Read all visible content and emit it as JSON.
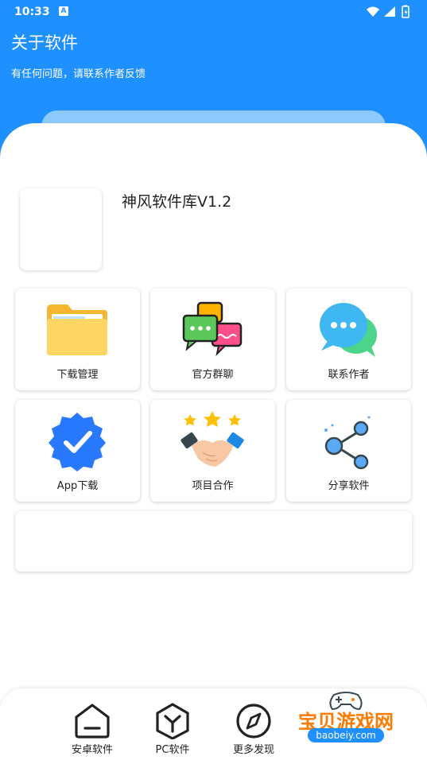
{
  "status_bar": {
    "time": "10:33",
    "notification_glyph": "A"
  },
  "header": {
    "title": "关于软件",
    "subtitle": "有任何问题，请联系作者反馈"
  },
  "app": {
    "name": "神风软件库V1.2"
  },
  "grid": [
    {
      "label": "下载管理",
      "icon": "folder-icon"
    },
    {
      "label": "官方群聊",
      "icon": "chat-group-icon"
    },
    {
      "label": "联系作者",
      "icon": "message-bubble-icon"
    },
    {
      "label": "App下载",
      "icon": "verified-badge-icon"
    },
    {
      "label": "项目合作",
      "icon": "handshake-icon"
    },
    {
      "label": "分享软件",
      "icon": "share-icon"
    }
  ],
  "bottom_nav": [
    {
      "label": "安卓软件",
      "icon": "home-icon"
    },
    {
      "label": "PC软件",
      "icon": "hexagon-y-icon"
    },
    {
      "label": "更多发现",
      "icon": "compass-icon"
    }
  ],
  "watermark": {
    "text": "宝贝游戏网",
    "url": "baobeiy.com"
  },
  "colors": {
    "primary": "#1e90ff",
    "accent_pill": "#8ec9fb",
    "watermark": "#ff7a00"
  }
}
